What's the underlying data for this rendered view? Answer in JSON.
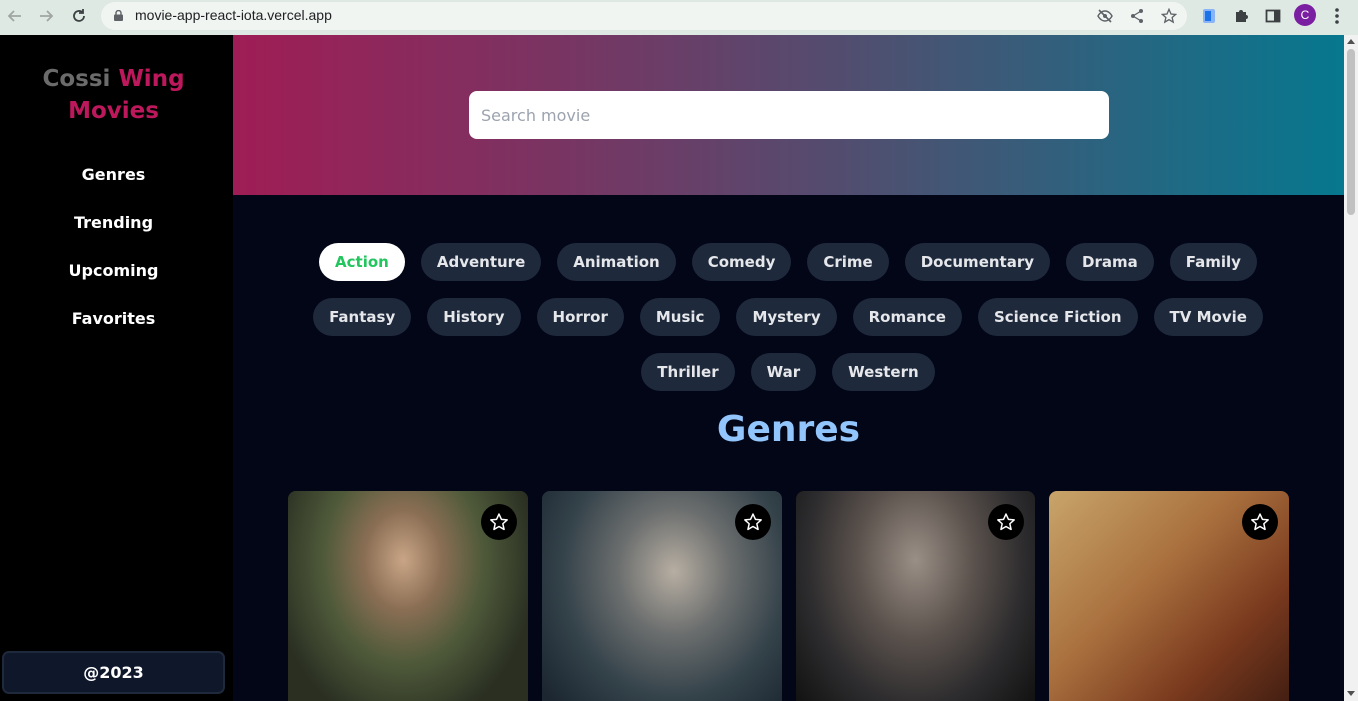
{
  "browser": {
    "url": "movie-app-react-iota.vercel.app",
    "profile_initial": "C",
    "icons": [
      "back-arrow-icon",
      "forward-arrow-icon",
      "reload-icon",
      "lock-icon",
      "eye-off-icon",
      "share-icon",
      "star-icon",
      "extension-icon",
      "puzzle-icon",
      "side-panel-icon",
      "kebab-menu-icon"
    ]
  },
  "sidebar": {
    "brand": {
      "part1": "Cossi",
      "part2": "Wing",
      "part3": "Movies"
    },
    "items": [
      {
        "label": "Genres"
      },
      {
        "label": "Trending"
      },
      {
        "label": "Upcoming"
      },
      {
        "label": "Favorites"
      }
    ],
    "footer": "@2023"
  },
  "search": {
    "placeholder": "Search movie"
  },
  "genres": [
    {
      "label": "Action",
      "active": true
    },
    {
      "label": "Adventure"
    },
    {
      "label": "Animation"
    },
    {
      "label": "Comedy"
    },
    {
      "label": "Crime"
    },
    {
      "label": "Documentary"
    },
    {
      "label": "Drama"
    },
    {
      "label": "Family"
    },
    {
      "label": "Fantasy"
    },
    {
      "label": "History"
    },
    {
      "label": "Horror"
    },
    {
      "label": "Music"
    },
    {
      "label": "Mystery"
    },
    {
      "label": "Romance"
    },
    {
      "label": "Science Fiction"
    },
    {
      "label": "TV Movie"
    },
    {
      "label": "Thriller"
    },
    {
      "label": "War"
    },
    {
      "label": "Western"
    }
  ],
  "section_title": "Genres",
  "movies": [
    {
      "poster_icon": "movie-poster-image",
      "fav_icon": "star-outline-icon"
    },
    {
      "poster_icon": "movie-poster-image",
      "fav_icon": "star-outline-icon"
    },
    {
      "poster_icon": "movie-poster-image",
      "fav_icon": "star-outline-icon"
    },
    {
      "poster_icon": "movie-poster-image",
      "fav_icon": "star-outline-icon"
    }
  ],
  "colors": {
    "sidebar_bg": "#000000",
    "main_bg": "#020617",
    "brand_pink": "#be185d",
    "brand_gray": "#6b6b6b",
    "chip_bg": "#1e293b",
    "active_chip_text": "#22c55e",
    "title_blue": "#93c5fd",
    "hero_gradient_start": "#9f1d55",
    "hero_gradient_end": "#06788f"
  }
}
